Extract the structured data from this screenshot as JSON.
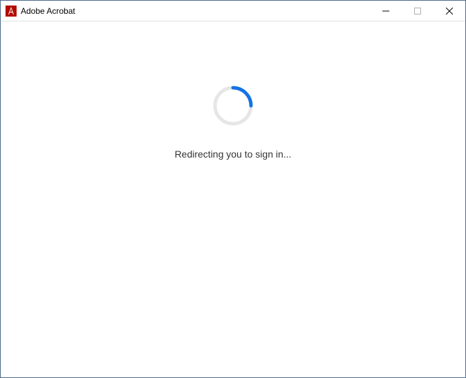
{
  "window": {
    "title": "Adobe Acrobat"
  },
  "content": {
    "status_message": "Redirecting you to sign in..."
  },
  "colors": {
    "spinner_track": "#e6e6e6",
    "spinner_arc": "#1473e6",
    "app_icon_bg": "#b30b00",
    "app_icon_fg": "#ffffff"
  }
}
